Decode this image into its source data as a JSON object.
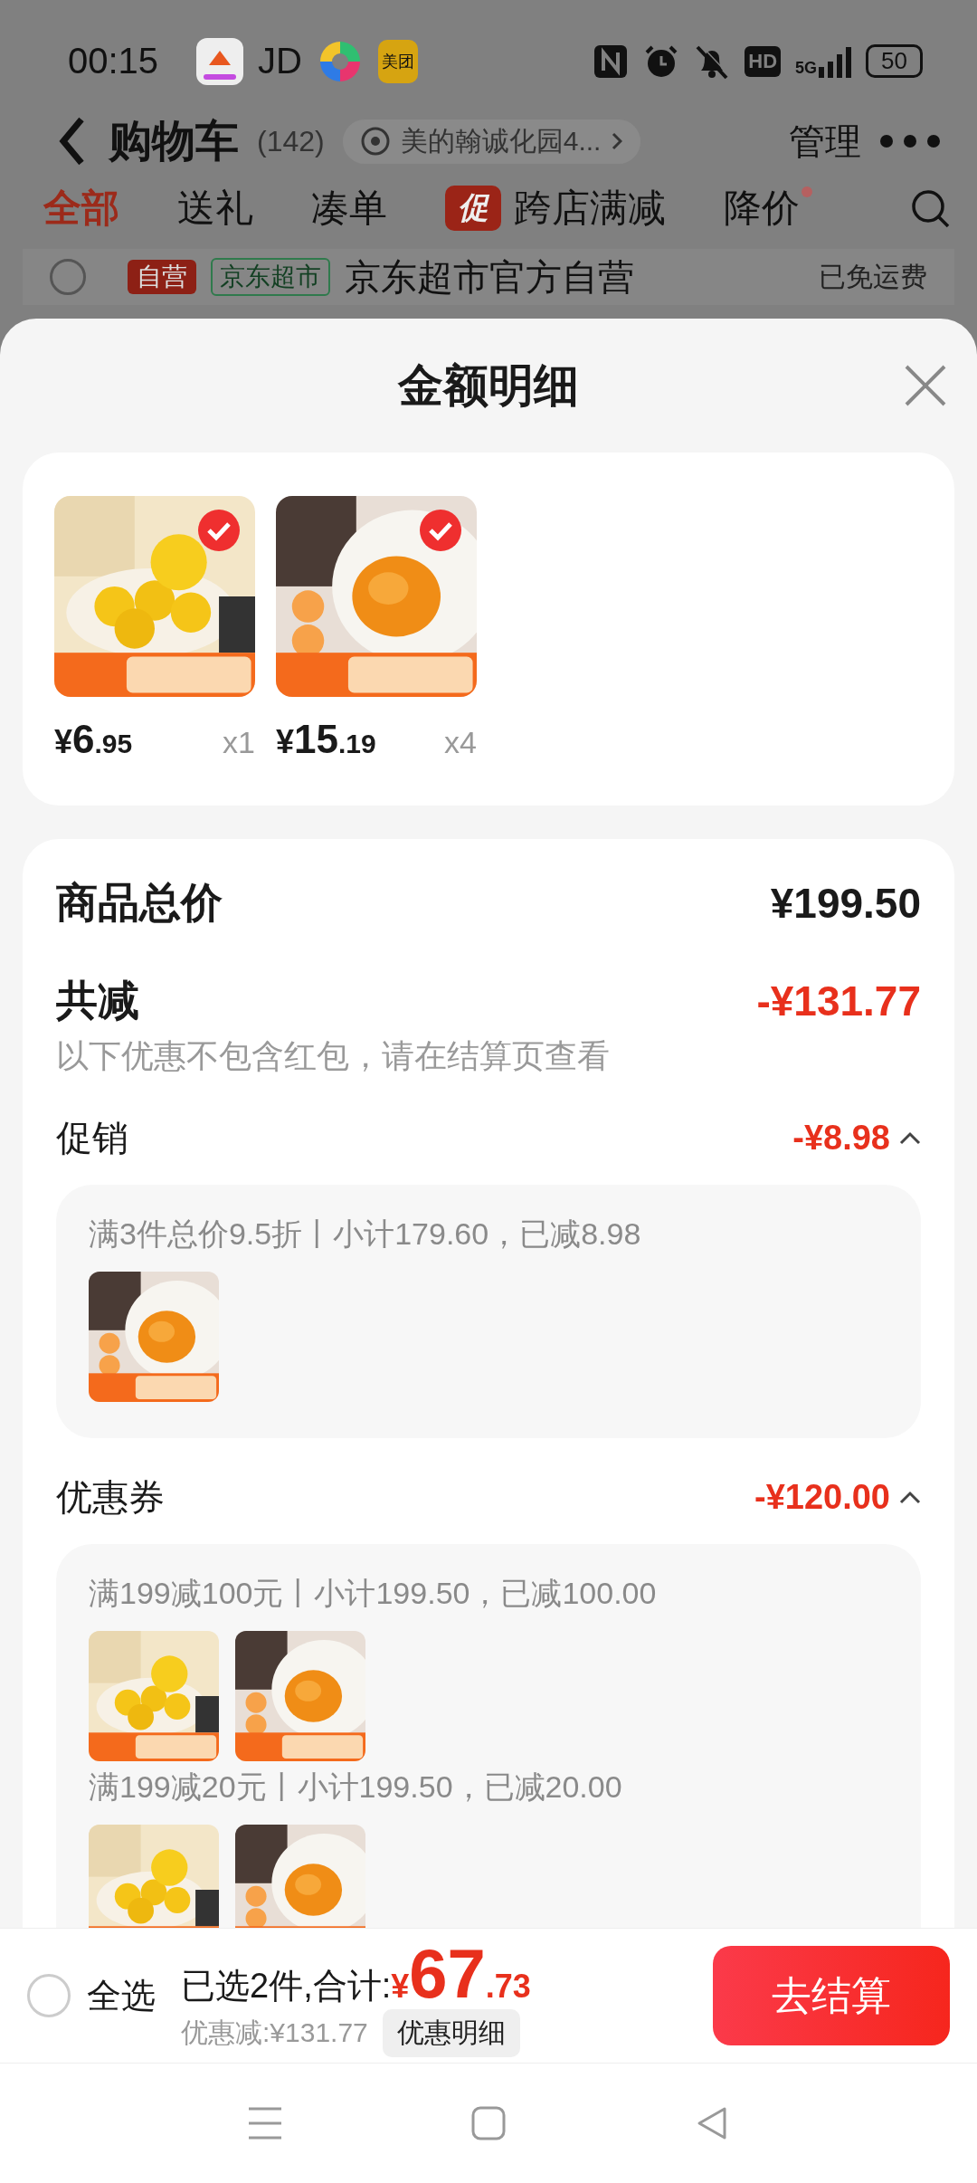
{
  "status_bar": {
    "time": "00:15",
    "app_label": "JD",
    "app_badge": "美团",
    "hd": "HD",
    "network": "5G",
    "battery": "50"
  },
  "background_page": {
    "title": "购物车",
    "count": "(142)",
    "address": "美的翰诚化园4...",
    "manage": "管理",
    "tabs": [
      {
        "label": "全部",
        "selected": true
      },
      {
        "label": "送礼",
        "selected": false
      },
      {
        "label": "凑单",
        "selected": false
      },
      {
        "label": "跨店满减",
        "selected": false,
        "badge": "促"
      },
      {
        "label": "降价",
        "selected": false,
        "dot": true
      }
    ],
    "store": {
      "checked": false,
      "badges": [
        "自营",
        "京东超市"
      ],
      "name": "京东超市官方自营",
      "shipping": "已免运费"
    }
  },
  "sheet": {
    "title": "金额明细",
    "products": [
      {
        "kind": "picture",
        "selected": true,
        "price": {
          "symbol": "¥",
          "integer": "6",
          "decimal": ".95"
        },
        "qty": "x1"
      },
      {
        "kind": "picture",
        "selected": true,
        "price": {
          "symbol": "¥",
          "integer": "15",
          "decimal": ".19"
        },
        "qty": "x4"
      }
    ],
    "total_label": "商品总价",
    "total": "¥199.50",
    "discount_label": "共减",
    "discount": "-¥131.77",
    "note": "以下优惠不包含红包，请在结算页查看",
    "sections": [
      {
        "title": "促销",
        "amount": "-¥8.98",
        "expanded": true,
        "groups": [
          {
            "rule": "满3件总价9.5折丨小计179.60，已减8.98"
          }
        ]
      },
      {
        "title": "优惠券",
        "amount": "-¥120.00",
        "expanded": true,
        "groups": [
          {
            "rule": "满199减100元丨小计199.50，已减100.00"
          },
          {
            "rule": "满199减20元丨小计199.50，已减20.00"
          }
        ]
      }
    ]
  },
  "bottom_bar": {
    "select_all": {
      "label": "全选",
      "checked": false
    },
    "summary": "已选2件,合计:",
    "total": {
      "symbol": "¥",
      "integer": "67",
      "decimal": ".73"
    },
    "savings": "优惠减:¥131.77",
    "detail_button": "优惠明细",
    "checkout": "去结算"
  }
}
